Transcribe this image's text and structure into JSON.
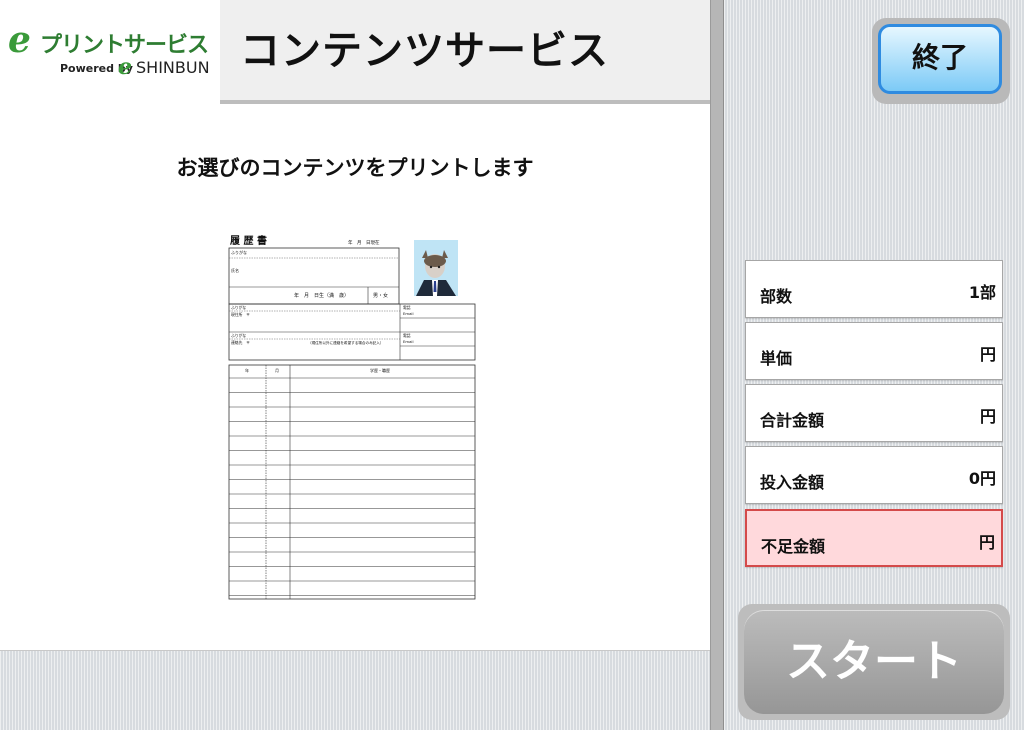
{
  "header": {
    "logo": {
      "brand": "プリントサービス",
      "powered_by": "Powered by",
      "company": "SHINBUN"
    },
    "title": "コンテンツサービス"
  },
  "main": {
    "instruction": "お選びのコンテンツをプリントします",
    "preview": {
      "doc_title": "履 歴 書",
      "date_line": "年　月　日現在",
      "furigana": "ふりがな",
      "name_label": "氏名",
      "birth_line": "年　月　日生（満　歳）",
      "sex": "男・女",
      "furigana2": "ふりがな",
      "address_label": "現住所　〒",
      "phone_label": "電話",
      "email_label": "Email",
      "furigana3": "ふりがな",
      "contact_label": "連絡先　〒",
      "contact_note": "（現住所以外に連絡を希望する場合のみ記入）",
      "phone_label2": "電話",
      "email_label2": "Email",
      "col_year": "年",
      "col_month": "月",
      "col_history": "学歴・職歴"
    }
  },
  "side": {
    "end_button": "終了",
    "rows": [
      {
        "label": "部数",
        "value": "1部"
      },
      {
        "label": "単価",
        "value": "円"
      },
      {
        "label": "合計金額",
        "value": "円"
      },
      {
        "label": "投入金額",
        "value": "0円"
      },
      {
        "label": "不足金額",
        "value": "円"
      }
    ],
    "start_button": "スタート"
  },
  "colors": {
    "accent_blue": "#2f8be0",
    "alert_red": "#d44a4a",
    "brand_green": "#2e7d32"
  }
}
